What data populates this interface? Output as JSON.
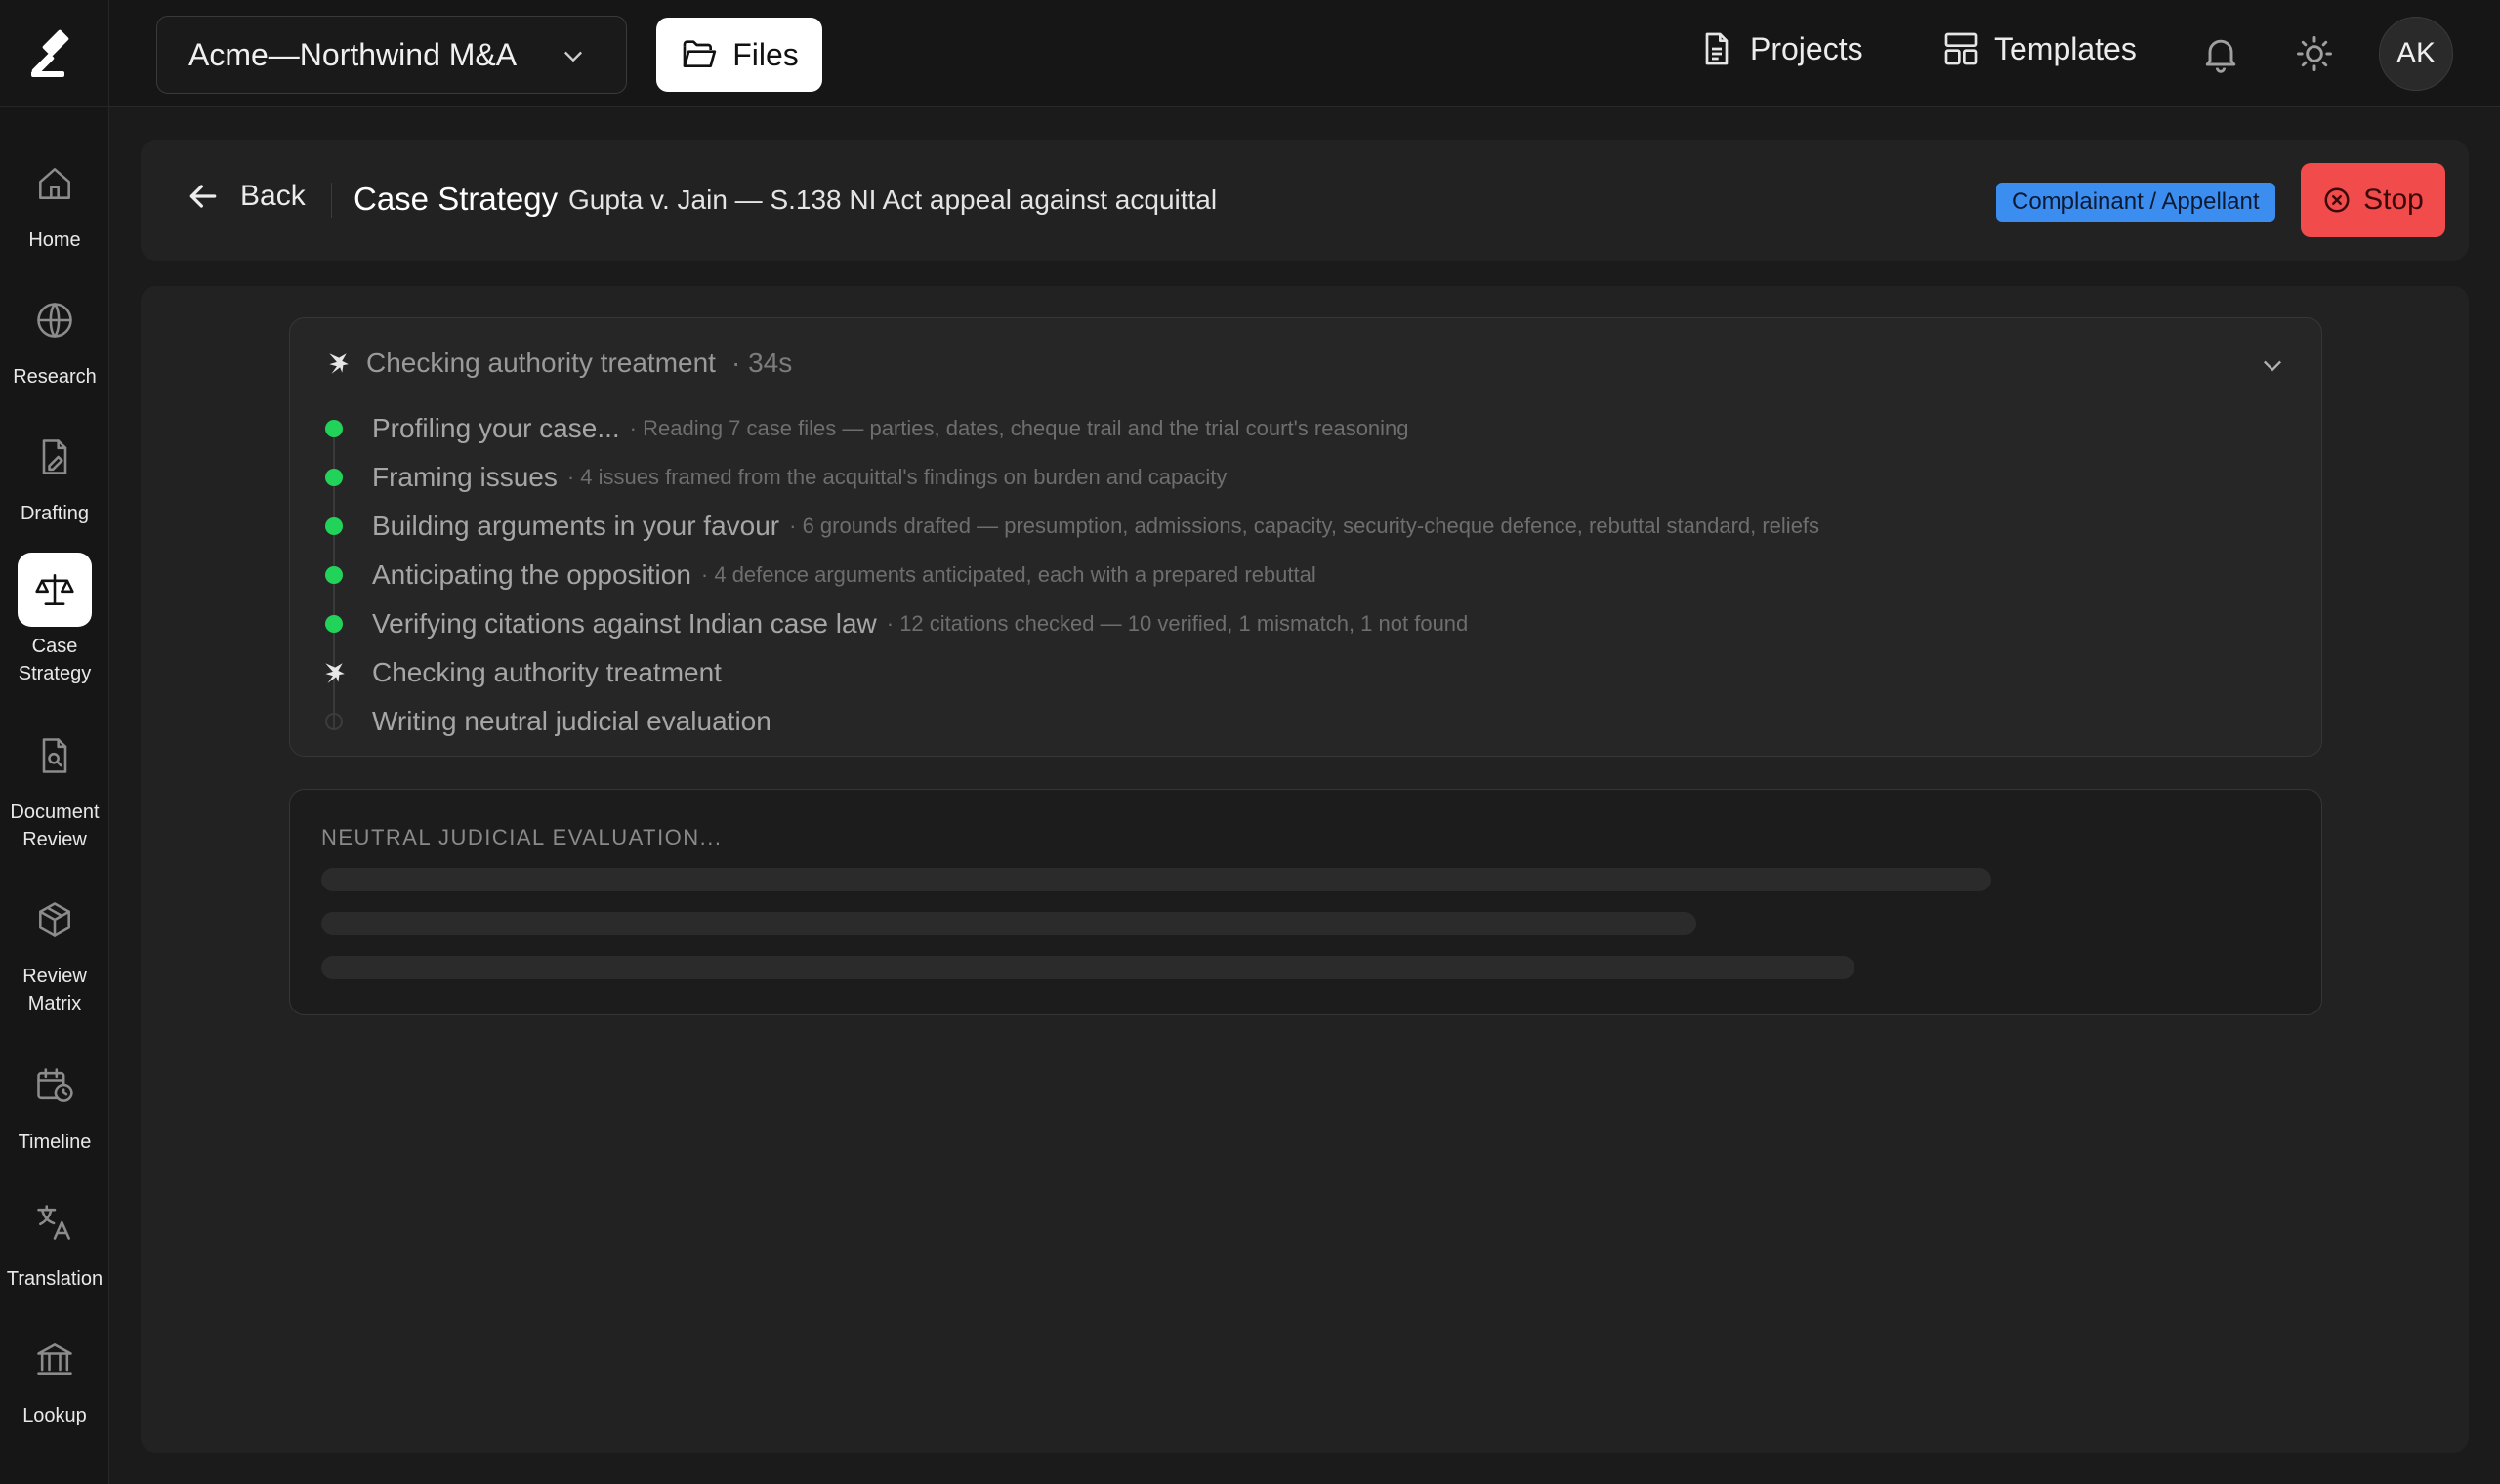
{
  "app": {
    "workspace": "Acme—Northwind M&A",
    "files_label": "Files",
    "nav": {
      "projects": "Projects",
      "templates": "Templates"
    },
    "avatar_initials": "AK"
  },
  "sidebar": {
    "items": [
      {
        "label": "Home",
        "icon": "home-icon"
      },
      {
        "label": "Research",
        "icon": "globe-icon"
      },
      {
        "label": "Drafting",
        "icon": "document-pen-icon"
      },
      {
        "label": "Case\nStrategy",
        "icon": "scales-icon",
        "active": true
      },
      {
        "label": "Document\nReview",
        "icon": "document-search-icon"
      },
      {
        "label": "Review\nMatrix",
        "icon": "cube-icon"
      },
      {
        "label": "Timeline",
        "icon": "calendar-clock-icon"
      },
      {
        "label": "Translation",
        "icon": "translate-icon"
      },
      {
        "label": "Lookup",
        "icon": "bank-icon"
      }
    ]
  },
  "header": {
    "back_label": "Back",
    "title": "Case Strategy",
    "subtitle": "Gupta v. Jain — S.138 NI Act appeal against acquittal",
    "role_badge": "Complainant / Appellant",
    "stop_label": "Stop"
  },
  "progress": {
    "current_label": "Checking authority treatment",
    "elapsed": "· 34s",
    "steps": [
      {
        "label": "Profiling your case...",
        "detail": "· Reading 7 case files — parties, dates, cheque trail and the trial court's reasoning",
        "status": "done"
      },
      {
        "label": "Framing issues",
        "detail": "· 4 issues framed from the acquittal's findings on burden and capacity",
        "status": "done"
      },
      {
        "label": "Building arguments in your favour",
        "detail": "· 6 grounds drafted — presumption, admissions, capacity, security-cheque defence, rebuttal standard, reliefs",
        "status": "done"
      },
      {
        "label": "Anticipating the opposition",
        "detail": "· 4 defence arguments anticipated, each with a prepared rebuttal",
        "status": "done"
      },
      {
        "label": "Verifying citations against Indian case law",
        "detail": "· 12 citations checked — 10 verified, 1 mismatch, 1 not found",
        "status": "done"
      },
      {
        "label": "Checking authority treatment",
        "detail": "",
        "status": "running"
      },
      {
        "label": "Writing neutral judicial evaluation",
        "detail": "",
        "status": "pending"
      }
    ]
  },
  "evaluation": {
    "title": "NEUTRAL JUDICIAL EVALUATION..."
  },
  "colors": {
    "accent_done": "#22d35a",
    "badge_blue": "#3b8ef0",
    "stop_red": "#f24b4b"
  }
}
